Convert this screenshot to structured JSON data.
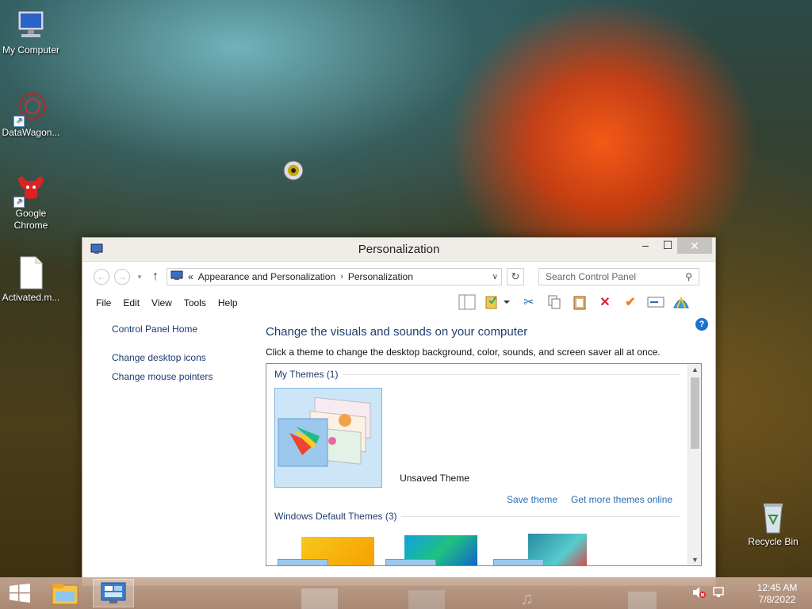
{
  "desktop": {
    "icons": [
      {
        "label": "My Computer"
      },
      {
        "label": "DataWagon..."
      },
      {
        "label": "Google Chrome"
      },
      {
        "label": "Activated.m..."
      },
      {
        "label": "Recycle Bin"
      }
    ]
  },
  "window": {
    "title": "Personalization",
    "controls": {
      "minimize": "–",
      "maximize": "☐",
      "close": "✕"
    },
    "nav": {
      "back": "←",
      "forward": "→",
      "recent": "▾",
      "up": "↑",
      "breadcrumb_prefix": "«",
      "breadcrumb": [
        "Appearance and Personalization",
        "Personalization"
      ],
      "breadcrumb_sep": "›",
      "dropdown": "∨",
      "refresh": "↻",
      "search_placeholder": "Search Control Panel"
    },
    "menu": [
      "File",
      "Edit",
      "View",
      "Tools",
      "Help"
    ],
    "help": "?",
    "left_pane": {
      "home": "Control Panel Home",
      "links": [
        "Change desktop icons",
        "Change mouse pointers"
      ]
    },
    "main": {
      "heading": "Change the visuals and sounds on your computer",
      "description": "Click a theme to change the desktop background, color, sounds, and screen saver all at once.",
      "my_themes_title": "My Themes (1)",
      "selected_theme": "Unsaved Theme",
      "save_theme": "Save theme",
      "get_more": "Get more themes online",
      "default_themes_title": "Windows Default Themes (3)"
    }
  },
  "taskbar": {
    "time": "12:45 AM",
    "date": "7/8/2022"
  },
  "colors": {
    "link": "#2a6cb0",
    "heading": "#1e3d6d",
    "selection": "#cde6f7",
    "taskbar": "#c0a08a"
  }
}
